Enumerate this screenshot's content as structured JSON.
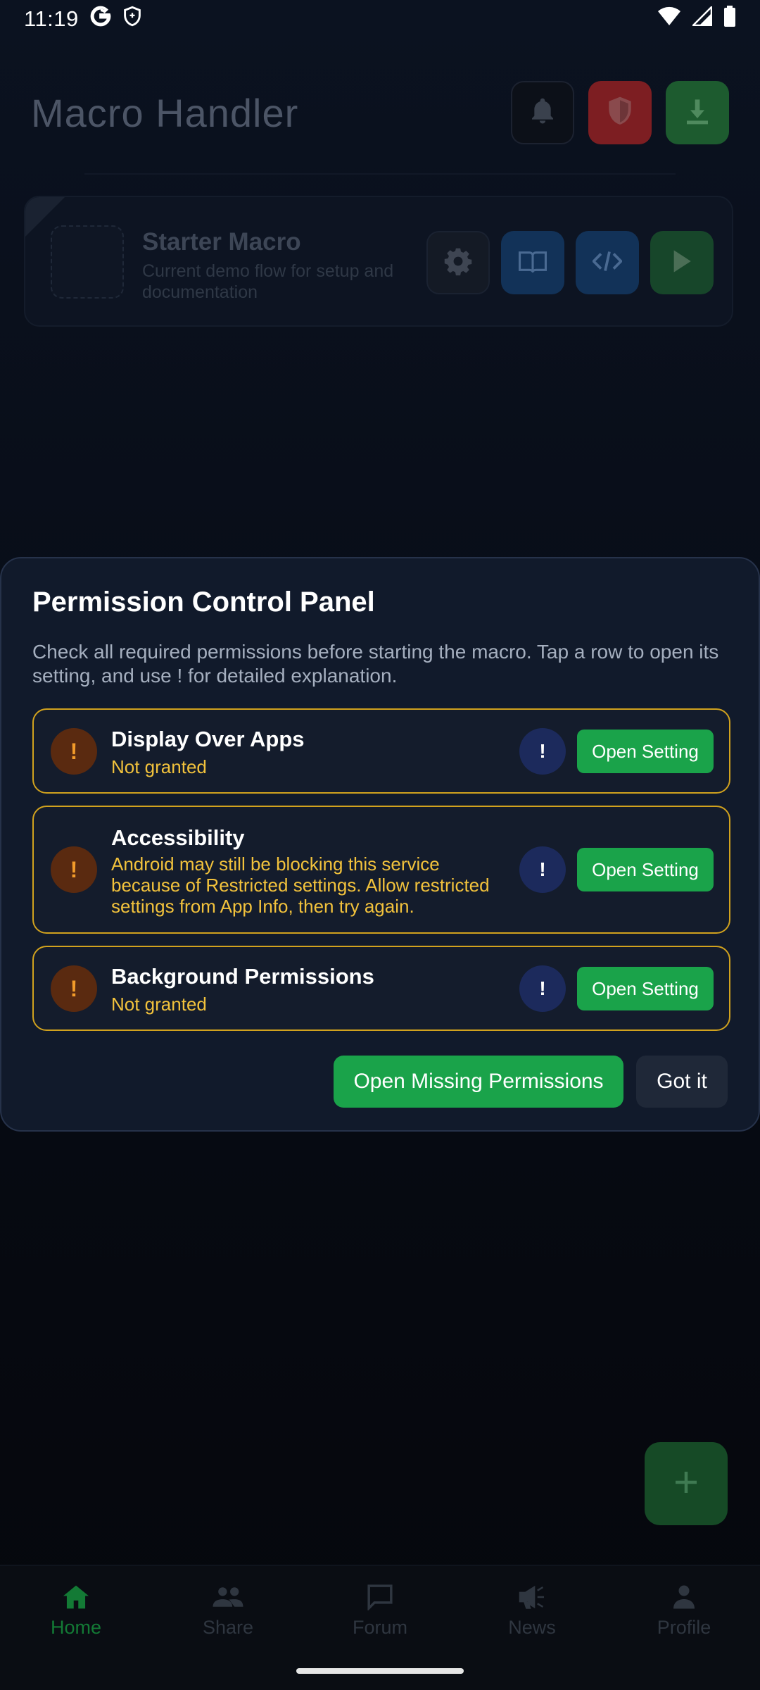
{
  "status_bar": {
    "time": "11:19",
    "left_icons": [
      "google-icon",
      "shield-outline-icon"
    ],
    "right_icons": [
      "wifi-icon",
      "signal-icon",
      "battery-icon"
    ]
  },
  "header": {
    "title": "Macro Handler",
    "actions": [
      {
        "icon": "bell-icon",
        "color": "#0c1018"
      },
      {
        "icon": "shield-icon",
        "color": "#7d1e22"
      },
      {
        "icon": "download-icon",
        "color": "#1d5b2f"
      }
    ]
  },
  "macro_card": {
    "title": "Starter Macro",
    "description": "Current demo flow for setup and documentation",
    "actions": [
      "gear-icon",
      "book-icon",
      "code-icon",
      "play-icon"
    ]
  },
  "permission_panel": {
    "title": "Permission Control Panel",
    "description": "Check all required permissions before starting the macro. Tap a row to open its setting, and use ! for detailed explanation.",
    "rows": [
      {
        "name": "Display Over Apps",
        "status": "Not granted",
        "status_icon": "!",
        "info_icon": "!",
        "button": "Open Setting"
      },
      {
        "name": "Accessibility",
        "status": "Android may still be blocking this service because of Restricted settings. Allow restricted settings from App Info, then try again.",
        "status_icon": "!",
        "info_icon": "!",
        "button": "Open Setting"
      },
      {
        "name": "Background Permissions",
        "status": "Not granted",
        "status_icon": "!",
        "info_icon": "!",
        "button": "Open Setting"
      }
    ],
    "primary_button": "Open Missing Permissions",
    "secondary_button": "Got it",
    "colors": {
      "warning_border": "#d1a21e",
      "status_text": "#f2c23c",
      "accent_green": "#1aa34a"
    }
  },
  "fab": {
    "icon": "plus-icon"
  },
  "bottom_nav": {
    "items": [
      {
        "label": "Home",
        "icon": "home-icon",
        "active": true
      },
      {
        "label": "Share",
        "icon": "people-icon",
        "active": false
      },
      {
        "label": "Forum",
        "icon": "chat-icon",
        "active": false
      },
      {
        "label": "News",
        "icon": "megaphone-icon",
        "active": false
      },
      {
        "label": "Profile",
        "icon": "person-icon",
        "active": false
      }
    ]
  }
}
